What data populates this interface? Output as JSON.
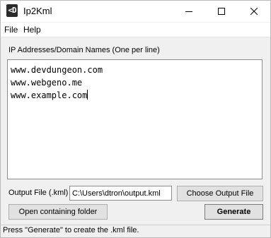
{
  "window": {
    "title": "Ip2Kml",
    "icon": "ip2kml-app-icon",
    "icon_glyph": "<D"
  },
  "menu": {
    "file": "File",
    "help": "Help"
  },
  "input": {
    "label": "IP Addresses/Domain Names (One per line)",
    "lines": [
      "www.devdungeon.com",
      "www.webgeno.me",
      "www.example.com"
    ]
  },
  "output": {
    "label": "Output File (.kml)",
    "value": "C:\\Users\\dtron\\output.kml",
    "choose_button": "Choose Output File"
  },
  "actions": {
    "open_folder": "Open containing folder",
    "generate": "Generate"
  },
  "status": {
    "text": "Press \"Generate\" to create the .kml file."
  }
}
